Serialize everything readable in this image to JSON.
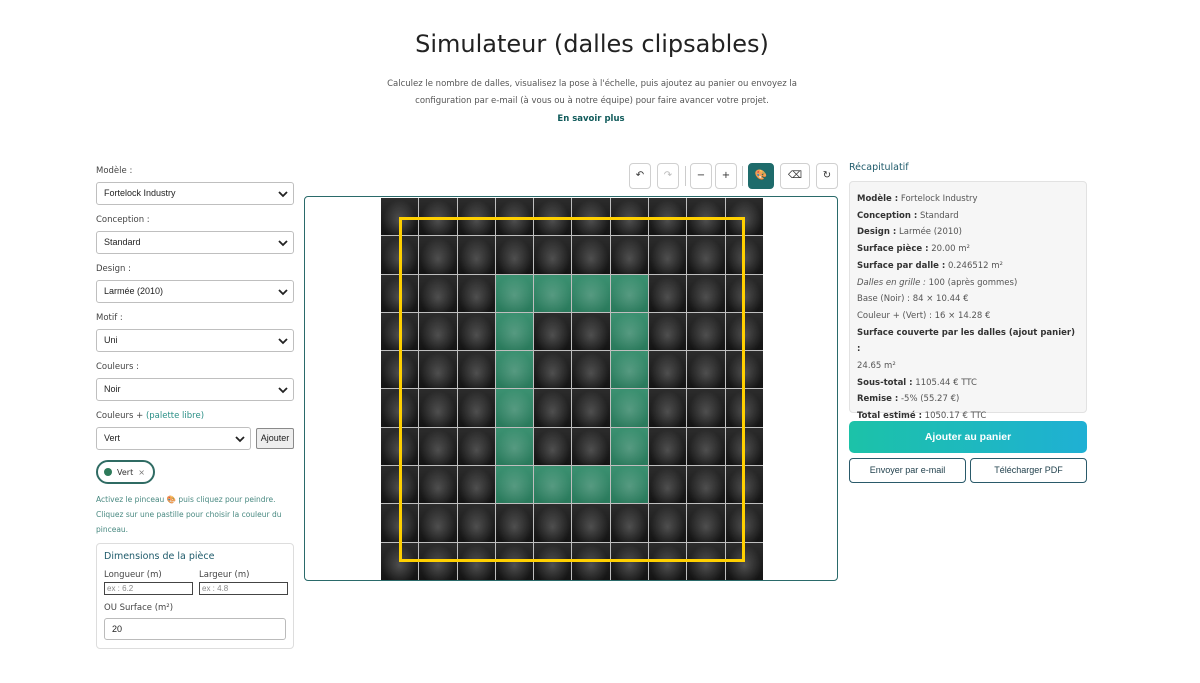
{
  "header": {
    "title": "Simulateur (dalles clipsables)",
    "subtitle": "Calculez le nombre de dalles, visualisez la pose à l'échelle, puis ajoutez au panier ou envoyez la configuration par e-mail (à vous ou à notre équipe) pour faire avancer votre projet.",
    "learn_more": "En savoir plus"
  },
  "form": {
    "model": {
      "label": "Modèle :",
      "value": "Fortelock Industry"
    },
    "conception": {
      "label": "Conception :",
      "value": "Standard"
    },
    "design": {
      "label": "Design :",
      "value": "Larmée (2010)"
    },
    "motif": {
      "label": "Motif :",
      "value": "Uni"
    },
    "colors": {
      "label": "Couleurs :",
      "value": "Noir"
    },
    "colors_plus": {
      "label": "Couleurs +",
      "label_accent": "(palette libre)",
      "value": "Vert",
      "add_label": "Ajouter",
      "chip_label": "Vert",
      "chip_remove": "×"
    },
    "hint": "Activez le pinceau 🎨 puis cliquez pour peindre. Cliquez sur une pastille pour choisir la couleur du pinceau.",
    "dimensions": {
      "title": "Dimensions de la pièce",
      "length_label": "Longueur (m)",
      "length_placeholder": "ex : 6.2",
      "width_label": "Largeur (m)",
      "width_placeholder": "ex : 4.8",
      "surface_label": "OU Surface (m²)",
      "surface_value": "20"
    }
  },
  "toolbar": {
    "undo": "↶",
    "redo": "↷",
    "zoom_out": "−",
    "zoom_in": "+",
    "brush": "🎨",
    "eraser": "⌫",
    "reset": "↻"
  },
  "canvas": {
    "rows": 10,
    "cols": 10,
    "base_color": "#1a1a1a",
    "paint_color": "#2f8a68",
    "outline_color": "#ffd000",
    "green_cells": [
      [
        2,
        3
      ],
      [
        2,
        4
      ],
      [
        2,
        5
      ],
      [
        2,
        6
      ],
      [
        3,
        3
      ],
      [
        3,
        6
      ],
      [
        4,
        3
      ],
      [
        4,
        6
      ],
      [
        5,
        3
      ],
      [
        5,
        6
      ],
      [
        6,
        3
      ],
      [
        6,
        6
      ],
      [
        7,
        3
      ],
      [
        7,
        4
      ],
      [
        7,
        5
      ],
      [
        7,
        6
      ]
    ]
  },
  "recap": {
    "title": "Récapitulatif",
    "lines": [
      {
        "k": "Modèle :",
        "v": "Fortelock Industry",
        "style": "bold"
      },
      {
        "k": "Conception :",
        "v": "Standard",
        "style": "bold"
      },
      {
        "k": "Design :",
        "v": "Larmée (2010)",
        "style": "bold"
      },
      {
        "k": "Surface pièce :",
        "v": "20.00 m²",
        "style": "bold"
      },
      {
        "k": "Surface par dalle :",
        "v": "0.246512 m²",
        "style": "bold"
      },
      {
        "k": "Dalles en grille :",
        "v": "100 (après gommes)",
        "style": "italic"
      },
      {
        "k": "Base (Noir) : 84 × 10.44 €",
        "v": "",
        "style": "plain"
      },
      {
        "k": "Couleur + (Vert) : 16 × 14.28 €",
        "v": "",
        "style": "plain"
      },
      {
        "k": "Surface couverte par les dalles (ajout panier) :",
        "v": "",
        "style": "bold"
      },
      {
        "k": "24.65 m²",
        "v": "",
        "style": "plain"
      },
      {
        "k": "Sous-total :",
        "v": "1105.44 € TTC",
        "style": "bold"
      },
      {
        "k": "Remise :",
        "v": "-5% (55.27 €)",
        "style": "bold"
      },
      {
        "k": "Total estimé :",
        "v": "1050.17 € TTC",
        "style": "bold"
      }
    ],
    "add_to_cart": "Ajouter au panier",
    "send_email": "Envoyer par e-mail",
    "download_pdf": "Télécharger PDF"
  }
}
